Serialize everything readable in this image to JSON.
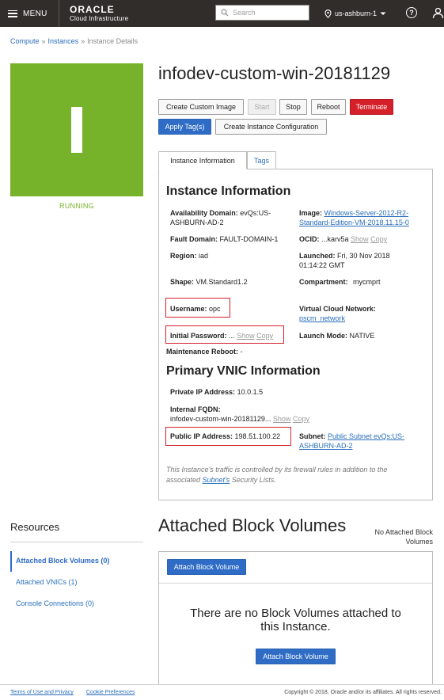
{
  "topbar": {
    "menu_label": "MENU",
    "brand": "ORACLE",
    "brand_sub": "Cloud Infrastructure",
    "search_placeholder": "Search",
    "region": "us-ashburn-1",
    "help_glyph": "?"
  },
  "breadcrumb": {
    "items": [
      "Compute",
      "Instances",
      "Instance Details"
    ],
    "separator": "»"
  },
  "instance": {
    "letter": "I",
    "state": "RUNNING",
    "name": "infodev-custom-win-20181129",
    "tile_color": "#77b22b"
  },
  "actions": {
    "create_image": "Create Custom Image",
    "start": "Start",
    "stop": "Stop",
    "reboot": "Reboot",
    "terminate": "Terminate",
    "apply_tags": "Apply Tag(s)",
    "create_config": "Create Instance Configuration"
  },
  "tabs": [
    "Instance Information",
    "Tags"
  ],
  "instance_info": {
    "heading": "Instance Information",
    "availability_domain_label": "Availability Domain:",
    "availability_domain_1": "evQs:US-",
    "availability_domain_2": "ASHBURN-AD-2",
    "fault_domain_label": "Fault Domain:",
    "fault_domain": "FAULT-DOMAIN-1",
    "region_label": "Region:",
    "region": "iad",
    "shape_label": "Shape:",
    "shape": "VM.Standard1.2",
    "username_label": "Username:",
    "username": "opc",
    "password_label": "Initial Password:",
    "password": "...",
    "maintenance_label": "Maintenance Reboot:",
    "maintenance": "-",
    "image_label": "Image:",
    "image_1": "Windows-Server-2012-R2-",
    "image_2": "Standard-Edition-VM-2018.11.15-0",
    "ocid_label": "OCID:",
    "ocid": "...karv5a",
    "launched_label": "Launched:",
    "launched_1": "Fri, 30 Nov 2018",
    "launched_2": "01:14:22 GMT",
    "compartment_label": "Compartment:",
    "compartment": "mycmprt",
    "vcn_label": "Virtual Cloud Network:",
    "vcn": "pscm_network",
    "launch_mode_label": "Launch Mode:",
    "launch_mode": "NATIVE",
    "show": "Show",
    "copy": "Copy"
  },
  "vnic": {
    "heading": "Primary VNIC Information",
    "private_ip_label": "Private IP Address:",
    "private_ip": "10.0.1.5",
    "fqdn_label": "Internal FQDN:",
    "fqdn": "infodev-custom-win-20181129...",
    "public_ip_label": "Public IP Address:",
    "public_ip": "198.51.100.22",
    "subnet_label": "Subnet:",
    "subnet_1": "Public Subnet evQs:US-",
    "subnet_2": "ASHBURN-AD-2",
    "note_1": "This Instance's traffic is controlled by its firewall rules in addition to the",
    "note_2_pre": "associated ",
    "note_2_link": "Subnet's",
    "note_2_post": " Security Lists."
  },
  "resources": {
    "title": "Resources",
    "items": [
      "Attached Block Volumes (0)",
      "Attached VNICs (1)",
      "Console Connections (0)"
    ]
  },
  "block_volumes": {
    "title": "Attached Block Volumes",
    "none_1": "No Attached Block",
    "none_2": "Volumes",
    "attach_button": "Attach Block Volume",
    "empty_1": "There are no Block Volumes attached to",
    "empty_2": "this Instance.",
    "attach_button_center": "Attach Block Volume"
  },
  "footer": {
    "terms": "Terms of Use and Privacy",
    "cookies": "Cookie Preferences",
    "copyright": "Copyright © 2018, Oracle and/or its affiliates. All rights reserved."
  }
}
